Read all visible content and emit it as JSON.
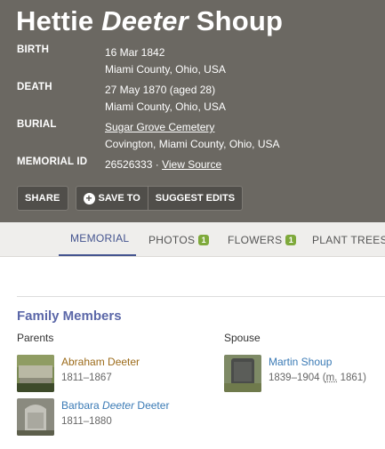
{
  "memorial": {
    "first": "Hettie",
    "maiden": "Deeter",
    "last": "Shoup"
  },
  "facts": {
    "birth_label": "BIRTH",
    "birth_date": "16 Mar 1842",
    "birth_place": "Miami County, Ohio, USA",
    "death_label": "DEATH",
    "death_date": "27 May 1870 (aged 28)",
    "death_place": "Miami County, Ohio, USA",
    "burial_label": "BURIAL",
    "burial_cemetery": "Sugar Grove Cemetery",
    "burial_place": "Covington, Miami County, Ohio, USA",
    "memorial_id_label": "MEMORIAL ID",
    "memorial_id": "26526333",
    "separator": "·",
    "view_source": "View Source"
  },
  "actions": {
    "share": "SHARE",
    "save_to": "SAVE TO",
    "suggest_edits": "SUGGEST EDITS"
  },
  "tabs": {
    "memorial": "MEMORIAL",
    "photos": "PHOTOS",
    "photos_count": "1",
    "flowers": "FLOWERS",
    "flowers_count": "1",
    "plant_trees": "PLANT TREES"
  },
  "family": {
    "title": "Family Members",
    "parents_label": "Parents",
    "spouse_label": "Spouse",
    "father": {
      "name": "Abraham Deeter",
      "dates": "1811–1867"
    },
    "mother": {
      "first": "Barbara",
      "maiden": "Deeter",
      "last": "Deeter",
      "dates": "1811–1880"
    },
    "spouse": {
      "name": "Martin Shoup",
      "dates": "1839–1904",
      "marriage_abbr": "m.",
      "marriage_year": "1861"
    }
  },
  "colors": {
    "header_bg": "#6b6862",
    "accent": "#44548f",
    "badge_green": "#7ea93b",
    "link_blue": "#3a7ab5",
    "link_gold": "#9c6b1a"
  }
}
